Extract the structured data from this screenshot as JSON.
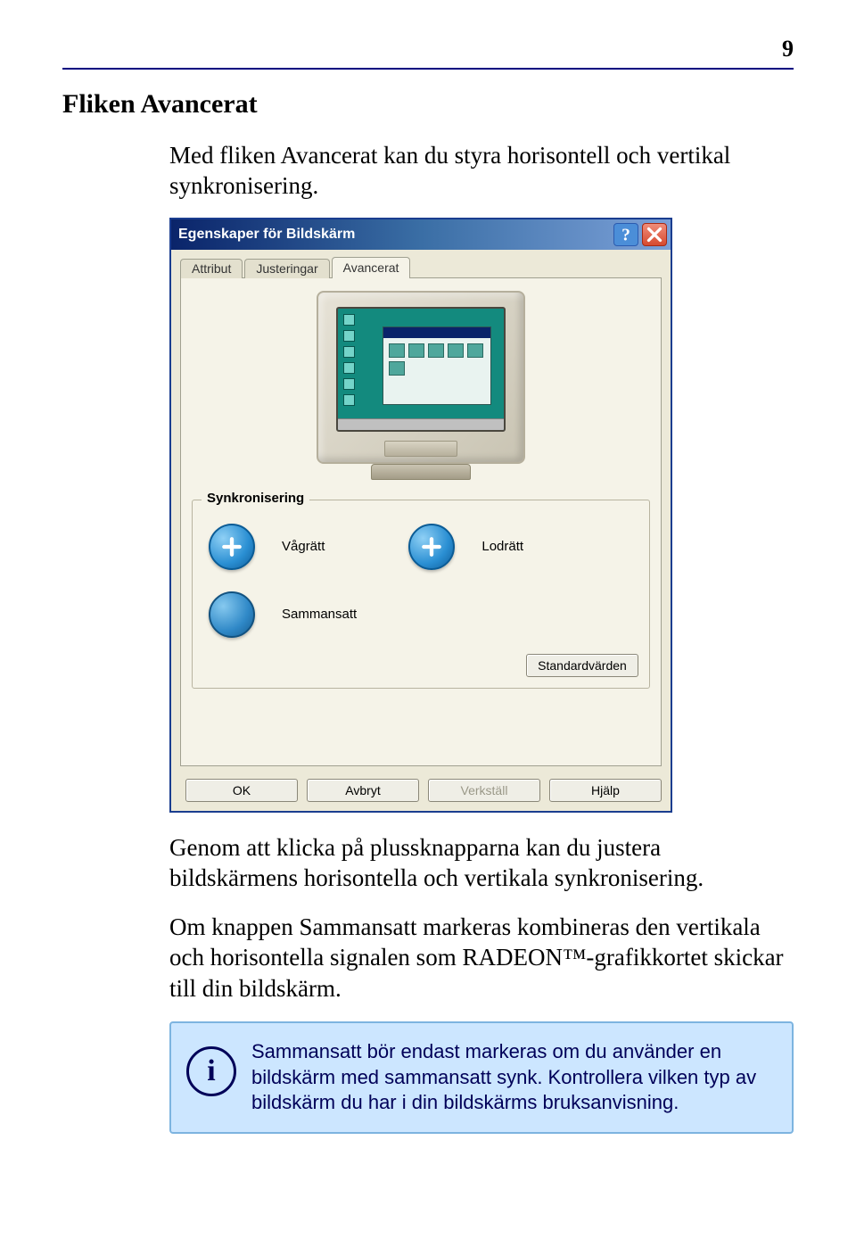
{
  "page_number": "9",
  "section_title": "Fliken Avancerat",
  "intro_text": "Med fliken Avancerat kan du styra horisontell och vertikal synkronisering.",
  "dialog": {
    "title": "Egenskaper för Bildskärm",
    "tabs": [
      "Attribut",
      "Justeringar",
      "Avancerat"
    ],
    "active_tab_index": 2,
    "group_title": "Synkronisering",
    "sync_horizontal": "Vågrätt",
    "sync_vertical": "Lodrätt",
    "sync_composite": "Sammansatt",
    "defaults_button": "Standardvärden",
    "buttons": {
      "ok": "OK",
      "cancel": "Avbryt",
      "apply": "Verkställ",
      "help": "Hjälp"
    }
  },
  "para1": "Genom att klicka på plussknapparna kan du justera bildskärmens horisontella och vertikala synkronisering.",
  "para2": "Om knappen Sammansatt markeras kombineras den vertikala och horisontella signalen som RADEON™-grafikkortet skickar till din bildskärm.",
  "info": {
    "icon_glyph": "i",
    "text": "Sammansatt bör endast markeras om du använder en bildskärm med sammansatt synk. Kontrollera vilken typ av bildskärm du har i din bildskärms bruksanvisning."
  }
}
